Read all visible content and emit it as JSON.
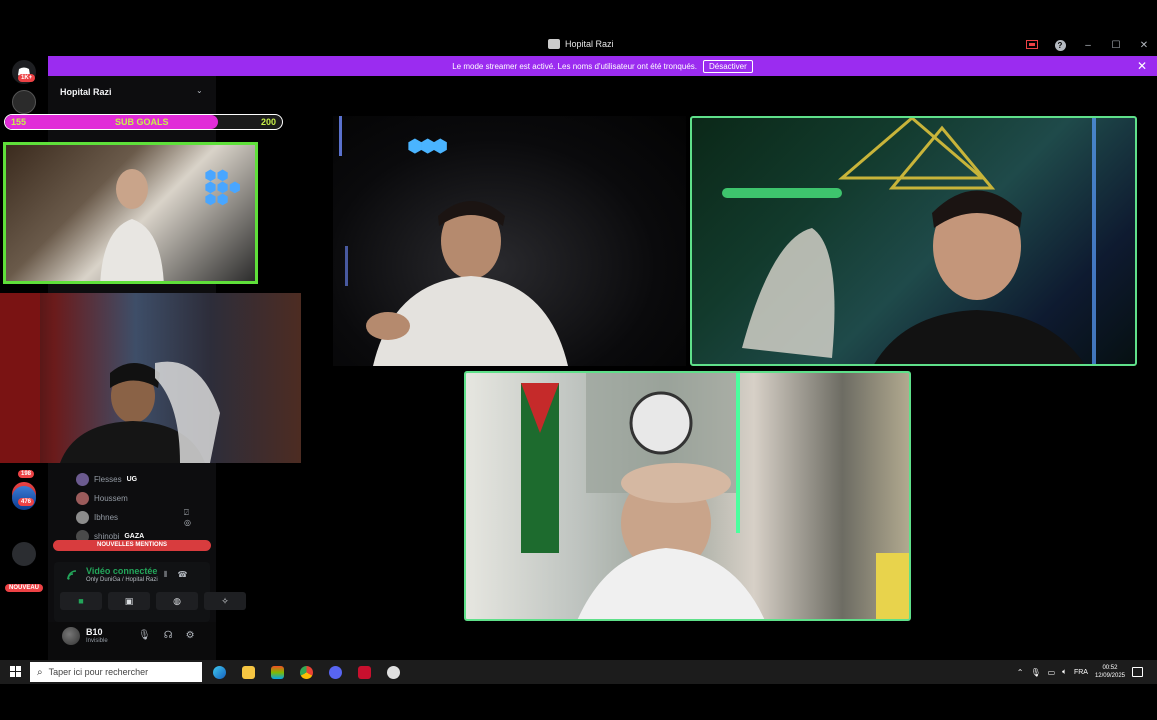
{
  "window": {
    "title": "Hopital Razi"
  },
  "banner": {
    "text": "Le mode streamer est activé. Les noms d'utilisateur ont été tronqués.",
    "button": "Désactiver"
  },
  "servers": {
    "badges": [
      "1K+",
      "198",
      "476"
    ],
    "new_label": "NOUVEAU"
  },
  "sidebar": {
    "server_name": "Hopital Razi",
    "members": [
      {
        "name": "Flesses",
        "tag": "UG",
        "avatar_color": "#6b5a8f"
      },
      {
        "name": "Houssem",
        "tag": "",
        "avatar_color": "#9b5b5b"
      },
      {
        "name": "Ibhnes",
        "tag": "",
        "avatar_color": "#8c8c8c"
      },
      {
        "name": "shinobi",
        "tag": "GAZA",
        "avatar_color": "#4a4a4a"
      }
    ],
    "mentions_label": "NOUVELLES MENTIONS"
  },
  "voice": {
    "status": "Vidéo connectée",
    "channel": "Only DuniGa / Hopital Razi"
  },
  "user": {
    "name": "B10",
    "status": "Invisible"
  },
  "overlay": {
    "subgoal_label": "SUB GOALS",
    "subgoal_current": "155",
    "subgoal_target": "200",
    "subgoal_progress": 0.77
  },
  "taskbar": {
    "search_placeholder": "Taper ici pour rechercher",
    "language": "FRA",
    "time": "00:52",
    "date": "12/09/2025"
  },
  "colors": {
    "banner": "#9b2cf0",
    "tile_border": "#5fe08a",
    "cam_border": "#5fe03a",
    "subgoal_fill": "#e12cd8",
    "voice_green": "#23a55a"
  }
}
